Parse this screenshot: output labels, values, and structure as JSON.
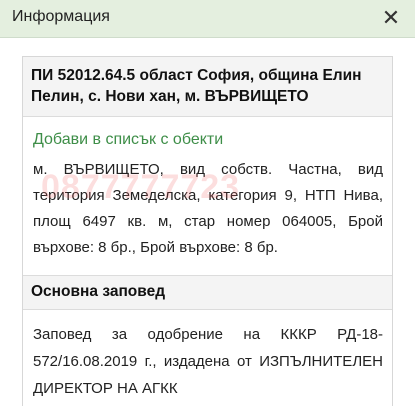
{
  "header": {
    "title": "Информация",
    "close_label": "✕"
  },
  "card": {
    "title": "ПИ 52012.64.5 област София, община Елин Пелин, с. Нови хан, м. ВЪРВИЩЕТО",
    "add_link": "Добави в списък с обекти",
    "description": "м. ВЪРВИЩЕТО, вид собств. Частна, вид територия Земеделска, категория 9, НТП Нива, площ 6497 кв. м, стар номер 064005, Брой върхове: 8 бр., Брой върхове: 8 бр.",
    "watermark": "0877777723",
    "section_title": "Основна заповед",
    "order_text": "Заповед за одобрение на КККР РД-18-572/16.08.2019 г., издадена от ИЗПЪЛНИТЕЛЕН ДИРЕКТОР НА АГКК"
  },
  "colors": {
    "header_bg": "#e4efdf",
    "link": "#3e8e48",
    "watermark": "#ee5a5a"
  },
  "icons": {
    "close": "close-icon"
  }
}
